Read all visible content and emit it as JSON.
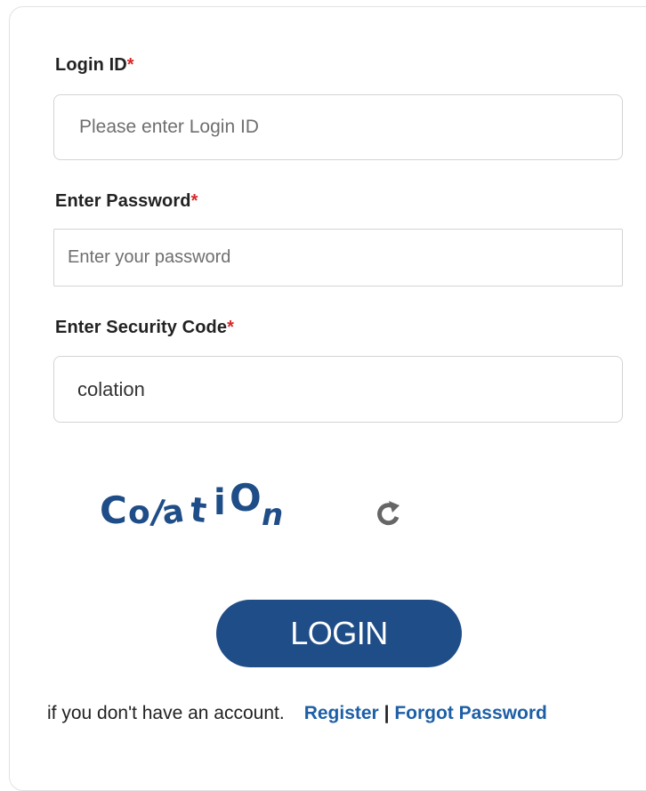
{
  "form": {
    "login_id": {
      "label": "Login ID",
      "required_marker": "*",
      "placeholder": "Please enter Login ID",
      "value": ""
    },
    "password": {
      "label": "Enter Password",
      "required_marker": "*",
      "placeholder": "Enter your password",
      "value": ""
    },
    "security_code": {
      "label": "Enter Security Code",
      "required_marker": "*",
      "placeholder": "",
      "value": "colation"
    },
    "captcha": {
      "text": "colation",
      "icon": "refresh-icon"
    },
    "login_button": {
      "label": "LOGIN"
    },
    "footer": {
      "prompt": "if you don't have an account.",
      "register_link": "Register",
      "separator": "|",
      "forgot_link": "Forgot Password"
    }
  },
  "colors": {
    "button_bg": "#1f4d87",
    "link": "#1d5fa6",
    "required": "#d62828",
    "captcha_text": "#1f4d87",
    "refresh_icon": "#666666"
  }
}
